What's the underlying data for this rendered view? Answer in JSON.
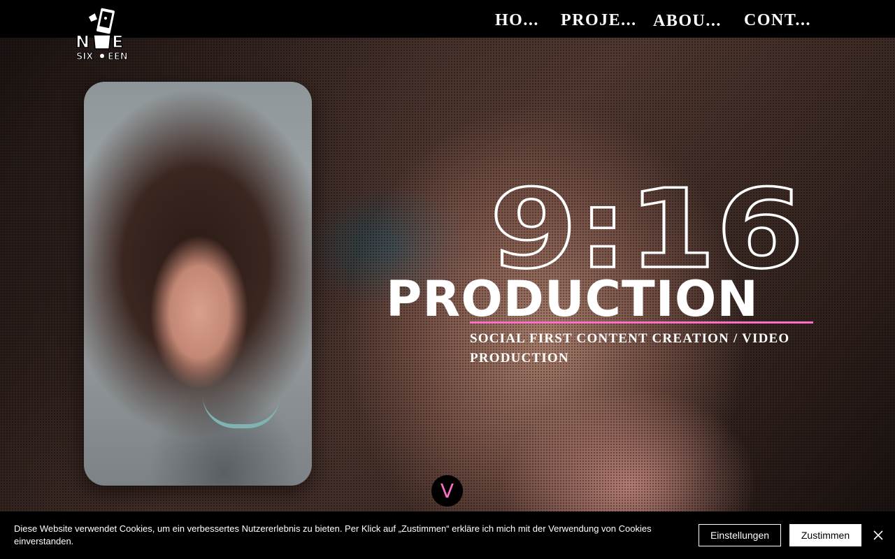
{
  "header": {
    "logo_alt": "Nine Sixteen",
    "nav": [
      {
        "label": "HO..."
      },
      {
        "label": "PROJE..."
      },
      {
        "label": "ABOU..."
      },
      {
        "label": "CONT..."
      }
    ]
  },
  "hero": {
    "headline_ratio": "9:16",
    "headline_word": "PRODUCTION",
    "subtitle": "SOCIAL FIRST CONTENT CREATION / VIDEO PRODUCTION",
    "scroll_label": "V"
  },
  "cookie": {
    "text": "Diese Website verwendet Cookies, um ein verbessertes Nutzererlebnis zu bieten. Per Klick auf „Zustimmen“ erkläre ich mich mit der Verwendung von Cookies einverstanden.",
    "settings_label": "Einstellungen",
    "accept_label": "Zustimmen"
  },
  "colors": {
    "accent": "#ff6ec7",
    "header_bg": "#000000",
    "text": "#ffffff"
  },
  "icons": {
    "logo": "phone-character-logo-icon",
    "scroll": "chevron-down-icon",
    "close": "close-icon"
  }
}
